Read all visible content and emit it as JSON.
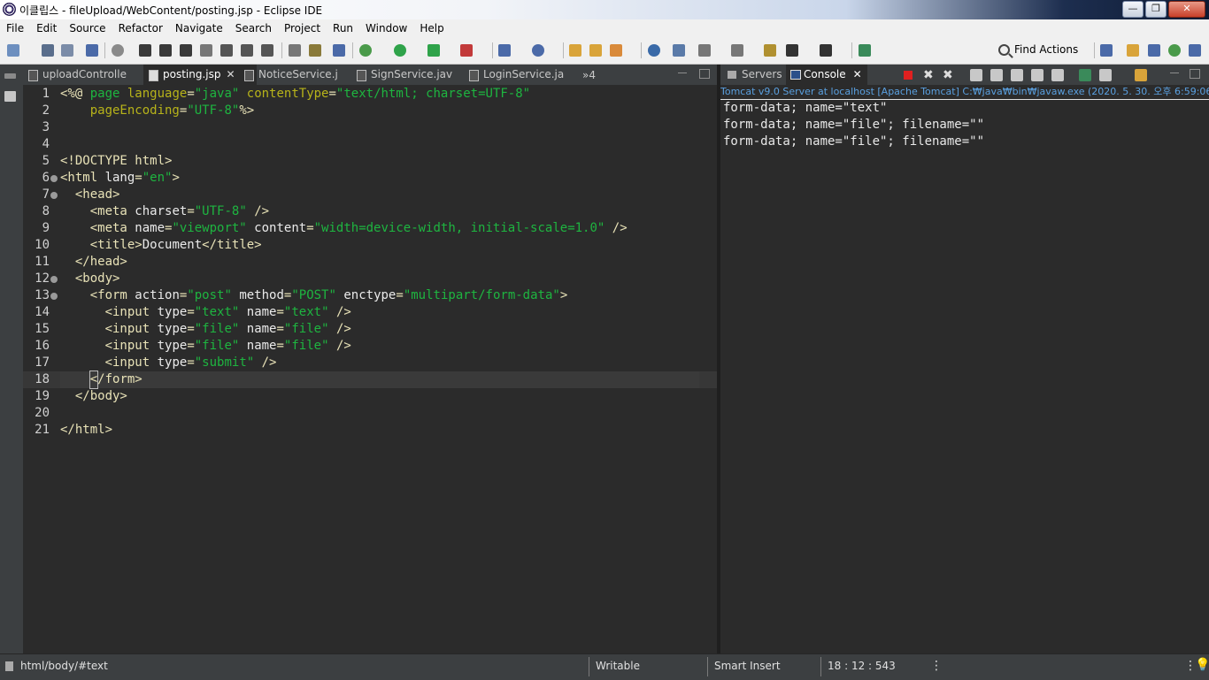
{
  "window": {
    "title": "이클립스 - fileUpload/WebContent/posting.jsp - Eclipse IDE",
    "minimize": "—",
    "maximize": "❐",
    "close": "✕"
  },
  "menu": [
    "File",
    "Edit",
    "Source",
    "Refactor",
    "Navigate",
    "Search",
    "Project",
    "Run",
    "Window",
    "Help"
  ],
  "toolbar": {
    "find_actions": "Find Actions"
  },
  "editor_tabs": [
    {
      "label": "uploadControlle",
      "active": false
    },
    {
      "label": "posting.jsp",
      "active": true,
      "close": "✕"
    },
    {
      "label": "NoticeService.j",
      "active": false
    },
    {
      "label": "SignService.jav",
      "active": false
    },
    {
      "label": "LoginService.ja",
      "active": false
    }
  ],
  "editor_overflow": "»4",
  "editor": {
    "current_line": 18,
    "lines": [
      {
        "n": "1",
        "fold": false,
        "tokens": [
          [
            "punct",
            "<%@ "
          ],
          [
            "kw",
            "page "
          ],
          [
            "attr",
            "language"
          ],
          [
            "punct",
            "="
          ],
          [
            "str",
            "\"java\" "
          ],
          [
            "attr",
            "contentType"
          ],
          [
            "punct",
            "="
          ],
          [
            "str",
            "\"text/html; charset=UTF-8\""
          ]
        ]
      },
      {
        "n": "2",
        "fold": false,
        "tokens": [
          [
            "punct",
            "    "
          ],
          [
            "attr",
            "pageEncoding"
          ],
          [
            "punct",
            "="
          ],
          [
            "str",
            "\"UTF-8\""
          ],
          [
            "punct",
            "%>"
          ]
        ]
      },
      {
        "n": "3",
        "fold": false,
        "tokens": []
      },
      {
        "n": "4",
        "fold": false,
        "tokens": []
      },
      {
        "n": "5",
        "fold": false,
        "tokens": [
          [
            "tag",
            "<!DOCTYPE html>"
          ]
        ]
      },
      {
        "n": "6",
        "fold": true,
        "tokens": [
          [
            "tag",
            "<html "
          ],
          [
            "text",
            "lang"
          ],
          [
            "punct",
            "="
          ],
          [
            "str",
            "\"en\""
          ],
          [
            "tag",
            ">"
          ]
        ]
      },
      {
        "n": "7",
        "fold": true,
        "tokens": [
          [
            "punct",
            "  "
          ],
          [
            "tag",
            "<head>"
          ]
        ]
      },
      {
        "n": "8",
        "fold": false,
        "tokens": [
          [
            "punct",
            "    "
          ],
          [
            "tag",
            "<meta "
          ],
          [
            "text",
            "charset"
          ],
          [
            "punct",
            "="
          ],
          [
            "str",
            "\"UTF-8\" "
          ],
          [
            "tag",
            "/>"
          ]
        ]
      },
      {
        "n": "9",
        "fold": false,
        "tokens": [
          [
            "punct",
            "    "
          ],
          [
            "tag",
            "<meta "
          ],
          [
            "text",
            "name"
          ],
          [
            "punct",
            "="
          ],
          [
            "str",
            "\"viewport\" "
          ],
          [
            "text",
            "content"
          ],
          [
            "punct",
            "="
          ],
          [
            "str",
            "\"width=device-width, initial-scale=1.0\" "
          ],
          [
            "tag",
            "/>"
          ]
        ]
      },
      {
        "n": "10",
        "fold": false,
        "tokens": [
          [
            "punct",
            "    "
          ],
          [
            "tag",
            "<title>"
          ],
          [
            "text",
            "Document"
          ],
          [
            "tag",
            "</title>"
          ]
        ]
      },
      {
        "n": "11",
        "fold": false,
        "tokens": [
          [
            "punct",
            "  "
          ],
          [
            "tag",
            "</head>"
          ]
        ]
      },
      {
        "n": "12",
        "fold": true,
        "tokens": [
          [
            "punct",
            "  "
          ],
          [
            "tag",
            "<body>"
          ]
        ]
      },
      {
        "n": "13",
        "fold": true,
        "tokens": [
          [
            "punct",
            "    "
          ],
          [
            "tag",
            "<form "
          ],
          [
            "text",
            "action"
          ],
          [
            "punct",
            "="
          ],
          [
            "str",
            "\"post\" "
          ],
          [
            "text",
            "method"
          ],
          [
            "punct",
            "="
          ],
          [
            "str",
            "\"POST\" "
          ],
          [
            "text",
            "enctype"
          ],
          [
            "punct",
            "="
          ],
          [
            "str",
            "\"multipart/form-data\""
          ],
          [
            "tag",
            ">"
          ]
        ]
      },
      {
        "n": "14",
        "fold": false,
        "tokens": [
          [
            "punct",
            "      "
          ],
          [
            "tag",
            "<input "
          ],
          [
            "text",
            "type"
          ],
          [
            "punct",
            "="
          ],
          [
            "str",
            "\"text\" "
          ],
          [
            "text",
            "name"
          ],
          [
            "punct",
            "="
          ],
          [
            "str",
            "\"text\" "
          ],
          [
            "tag",
            "/>"
          ]
        ]
      },
      {
        "n": "15",
        "fold": false,
        "tokens": [
          [
            "punct",
            "      "
          ],
          [
            "tag",
            "<input "
          ],
          [
            "text",
            "type"
          ],
          [
            "punct",
            "="
          ],
          [
            "str",
            "\"file\" "
          ],
          [
            "text",
            "name"
          ],
          [
            "punct",
            "="
          ],
          [
            "str",
            "\"file\" "
          ],
          [
            "tag",
            "/>"
          ]
        ]
      },
      {
        "n": "16",
        "fold": false,
        "tokens": [
          [
            "punct",
            "      "
          ],
          [
            "tag",
            "<input "
          ],
          [
            "text",
            "type"
          ],
          [
            "punct",
            "="
          ],
          [
            "str",
            "\"file\" "
          ],
          [
            "text",
            "name"
          ],
          [
            "punct",
            "="
          ],
          [
            "str",
            "\"file\" "
          ],
          [
            "tag",
            "/>"
          ]
        ]
      },
      {
        "n": "17",
        "fold": false,
        "tokens": [
          [
            "punct",
            "      "
          ],
          [
            "tag",
            "<input "
          ],
          [
            "text",
            "type"
          ],
          [
            "punct",
            "="
          ],
          [
            "str",
            "\"submit\" "
          ],
          [
            "tag",
            "/>"
          ]
        ]
      },
      {
        "n": "18",
        "fold": false,
        "tokens": [
          [
            "punct",
            "    "
          ],
          [
            "caret",
            "<"
          ],
          [
            "tag",
            "/form>"
          ]
        ]
      },
      {
        "n": "19",
        "fold": false,
        "tokens": [
          [
            "punct",
            "  "
          ],
          [
            "tag",
            "</body>"
          ]
        ]
      },
      {
        "n": "20",
        "fold": false,
        "tokens": []
      },
      {
        "n": "21",
        "fold": false,
        "tokens": [
          [
            "tag",
            "</html>"
          ]
        ]
      }
    ]
  },
  "console_view": {
    "tabs": [
      {
        "label": "Servers",
        "active": false
      },
      {
        "label": "Console",
        "active": true,
        "close": "✕"
      }
    ],
    "description": "Tomcat v9.0 Server at localhost [Apache Tomcat] C:₩java₩bin₩javaw.exe  (2020. 5. 30. 오후 6:59:06",
    "lines": [
      "form-data; name=\"text\"",
      "form-data; name=\"file\"; filename=\"\"",
      "form-data; name=\"file\"; filename=\"\""
    ]
  },
  "status": {
    "path": "html/body/#text",
    "writable": "Writable",
    "insert_mode": "Smart Insert",
    "position": "18 : 12 : 543"
  },
  "colors": {
    "editor_bg": "#2b2b2b",
    "keyword": "#1eb540",
    "attribute": "#b7b31a",
    "string": "#1eb540",
    "console_link": "#5aa0e0"
  }
}
